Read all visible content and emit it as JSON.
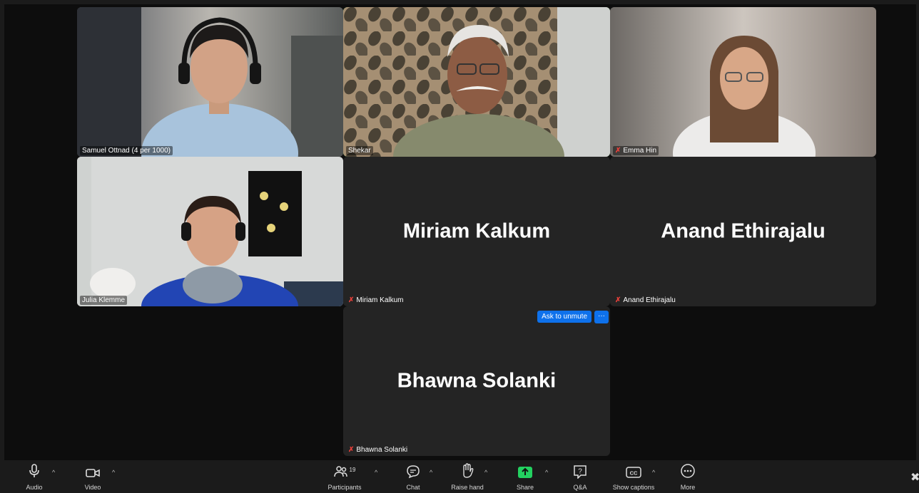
{
  "participants": {
    "samuel": {
      "name": "Samuel Ottnad (4 per 1000)"
    },
    "shekar": {
      "name": "Shekar"
    },
    "emma": {
      "name": "Emma Hin"
    },
    "julia": {
      "name": "Julia Klemme"
    },
    "miriam": {
      "display": "Miriam Kalkum",
      "name": "Miriam Kalkum"
    },
    "anand": {
      "display": "Anand Ethirajalu",
      "name": "Anand Ethirajalu"
    },
    "bhawna": {
      "display": "Bhawna Solanki",
      "name": "Bhawna Solanki",
      "ask_unmute": "Ask to unmute",
      "more": "···"
    }
  },
  "toolbar": {
    "audio": "Audio",
    "video": "Video",
    "participants": "Participants",
    "participants_count": "19",
    "chat": "Chat",
    "raise_hand": "Raise hand",
    "share": "Share",
    "qa": "Q&A",
    "captions": "Show captions",
    "more": "More"
  },
  "colors": {
    "active_speaker": "#23d160",
    "primary_button": "#0e71eb",
    "share": "#23d160",
    "muted": "#e8403a"
  }
}
